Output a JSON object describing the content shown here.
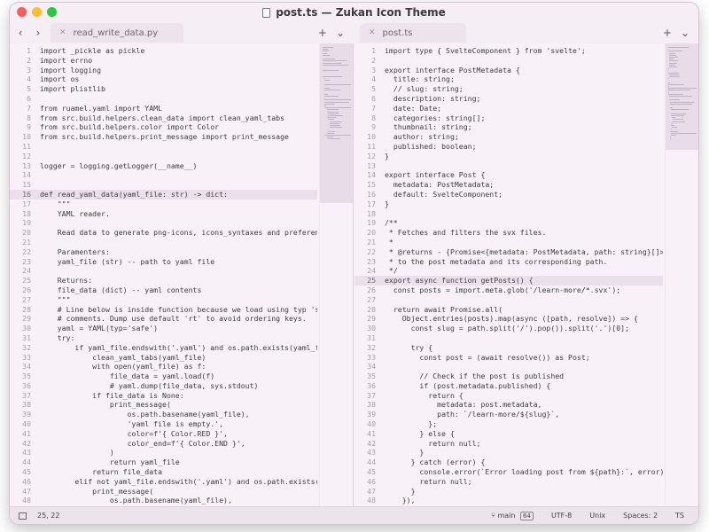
{
  "window": {
    "title": "post.ts — Zukan Icon Theme",
    "colors": {
      "close": "#ff5f57",
      "minimize": "#febc2e",
      "maximize": "#28c840",
      "background": "#f5eef5"
    }
  },
  "left_pane": {
    "tab": {
      "label": "read_write_data.py"
    },
    "active_line": "16",
    "lines": [
      {
        "n": "1",
        "t": "import _pickle as pickle"
      },
      {
        "n": "2",
        "t": "import errno"
      },
      {
        "n": "3",
        "t": "import logging"
      },
      {
        "n": "4",
        "t": "import os"
      },
      {
        "n": "5",
        "t": "import plistlib"
      },
      {
        "n": "6",
        "t": ""
      },
      {
        "n": "7",
        "t": "from ruamel.yaml import YAML"
      },
      {
        "n": "8",
        "t": "from src.build.helpers.clean_data import clean_yaml_tabs"
      },
      {
        "n": "9",
        "t": "from src.build.helpers.color import Color"
      },
      {
        "n": "10",
        "t": "from src.build.helpers.print_message import print_message"
      },
      {
        "n": "11",
        "t": ""
      },
      {
        "n": "12",
        "t": ""
      },
      {
        "n": "13",
        "t": "logger = logging.getLogger(__name__)"
      },
      {
        "n": "14",
        "t": ""
      },
      {
        "n": "15",
        "t": ""
      },
      {
        "n": "16",
        "t": "def read_yaml_data(yaml_file: str) -> dict:"
      },
      {
        "n": "17",
        "t": "    \"\"\""
      },
      {
        "n": "18",
        "t": "    YAML reader."
      },
      {
        "n": "19",
        "t": ""
      },
      {
        "n": "20",
        "t": "    Read data to generate png-icons, icons_syntaxes and preferenc"
      },
      {
        "n": "21",
        "t": ""
      },
      {
        "n": "22",
        "t": "    Paramenters:"
      },
      {
        "n": "23",
        "t": "    yaml_file (str) -- path to yaml file"
      },
      {
        "n": "24",
        "t": ""
      },
      {
        "n": "25",
        "t": "    Returns:"
      },
      {
        "n": "26",
        "t": "    file_data (dict) -- yaml contents"
      },
      {
        "n": "27",
        "t": "    \"\"\""
      },
      {
        "n": "28",
        "t": "    # Line below is inside function because we load using typ 'sa"
      },
      {
        "n": "29",
        "t": "    # comments. Dump use default 'rt' to avoid ordering keys."
      },
      {
        "n": "30",
        "t": "    yaml = YAML(typ='safe')"
      },
      {
        "n": "31",
        "t": "    try:"
      },
      {
        "n": "32",
        "t": "        if yaml_file.endswith('.yaml') and os.path.exists(yaml_fi"
      },
      {
        "n": "33",
        "t": "            clean_yaml_tabs(yaml_file)"
      },
      {
        "n": "34",
        "t": "            with open(yaml_file) as f:"
      },
      {
        "n": "35",
        "t": "                file_data = yaml.load(f)"
      },
      {
        "n": "36",
        "t": "                # yaml.dump(file_data, sys.stdout)"
      },
      {
        "n": "37",
        "t": "            if file_data is None:"
      },
      {
        "n": "38",
        "t": "                print_message("
      },
      {
        "n": "39",
        "t": "                    os.path.basename(yaml_file),"
      },
      {
        "n": "40",
        "t": "                    'yaml file is empty.',"
      },
      {
        "n": "41",
        "t": "                    color=f'{ Color.RED }',"
      },
      {
        "n": "42",
        "t": "                    color_end=f'{ Color.END }',"
      },
      {
        "n": "43",
        "t": "                )"
      },
      {
        "n": "44",
        "t": "                return yaml_file"
      },
      {
        "n": "45",
        "t": "            return file_data"
      },
      {
        "n": "46",
        "t": "        elif not yaml_file.endswith('.yaml') and os.path.exists(y"
      },
      {
        "n": "47",
        "t": "            print_message("
      },
      {
        "n": "48",
        "t": "                os.path.basename(yaml_file),"
      }
    ]
  },
  "right_pane": {
    "tab": {
      "label": "post.ts"
    },
    "active_line": "25",
    "lines": [
      {
        "n": "1",
        "t": "import type { SvelteComponent } from 'svelte';"
      },
      {
        "n": "2",
        "t": ""
      },
      {
        "n": "3",
        "t": "export interface PostMetadata {"
      },
      {
        "n": "4",
        "t": "  title: string;"
      },
      {
        "n": "5",
        "t": "  // slug: string;"
      },
      {
        "n": "6",
        "t": "  description: string;"
      },
      {
        "n": "7",
        "t": "  date: Date;"
      },
      {
        "n": "8",
        "t": "  categories: string[];"
      },
      {
        "n": "9",
        "t": "  thumbnail: string;"
      },
      {
        "n": "10",
        "t": "  author: string;"
      },
      {
        "n": "11",
        "t": "  published: boolean;"
      },
      {
        "n": "12",
        "t": "}"
      },
      {
        "n": "13",
        "t": ""
      },
      {
        "n": "14",
        "t": "export interface Post {"
      },
      {
        "n": "15",
        "t": "  metadata: PostMetadata;"
      },
      {
        "n": "16",
        "t": "  default: SvelteComponent;"
      },
      {
        "n": "17",
        "t": "}"
      },
      {
        "n": "18",
        "t": ""
      },
      {
        "n": "19",
        "t": "/**"
      },
      {
        "n": "20",
        "t": " * Fetches and filters the svx files."
      },
      {
        "n": "21",
        "t": " *"
      },
      {
        "n": "22",
        "t": " * @returns - {Promise<{metadata: PostMetadata, path: string}[]>}"
      },
      {
        "n": "23",
        "t": " * to the post metadata and its corresponding path."
      },
      {
        "n": "24",
        "t": " */"
      },
      {
        "n": "25",
        "t": "export async function getPosts() {"
      },
      {
        "n": "26",
        "t": "  const posts = import.meta.glob('/learn-more/*.svx');"
      },
      {
        "n": "27",
        "t": ""
      },
      {
        "n": "28",
        "t": "  return await Promise.all("
      },
      {
        "n": "29",
        "t": "    Object.entries(posts).map(async ([path, resolve]) => {"
      },
      {
        "n": "30",
        "t": "      const slug = path.split('/').pop()).split('.')[0];"
      },
      {
        "n": "31",
        "t": ""
      },
      {
        "n": "32",
        "t": "      try {"
      },
      {
        "n": "33",
        "t": "        const post = (await resolve()) as Post;"
      },
      {
        "n": "34",
        "t": ""
      },
      {
        "n": "35",
        "t": "        // Check if the post is published"
      },
      {
        "n": "36",
        "t": "        if (post.metadata.published) {"
      },
      {
        "n": "37",
        "t": "          return {"
      },
      {
        "n": "38",
        "t": "            metadata: post.metadata,"
      },
      {
        "n": "39",
        "t": "            path: `/learn-more/${slug}`,"
      },
      {
        "n": "40",
        "t": "          };"
      },
      {
        "n": "41",
        "t": "        } else {"
      },
      {
        "n": "42",
        "t": "          return null;"
      },
      {
        "n": "43",
        "t": "        }"
      },
      {
        "n": "44",
        "t": "      } catch (error) {"
      },
      {
        "n": "45",
        "t": "        console.error(`Error loading post from ${path}:`, error);"
      },
      {
        "n": "46",
        "t": "        return null;"
      },
      {
        "n": "47",
        "t": "      }"
      },
      {
        "n": "48",
        "t": "    }),"
      }
    ]
  },
  "status": {
    "position": "25, 22",
    "branch": "main",
    "branch_count": "64",
    "encoding": "UTF-8",
    "line_endings": "Unix",
    "indentation": "Spaces: 2",
    "syntax": "TS"
  },
  "icons": {
    "back": "chevron-left-icon",
    "forward": "chevron-right-icon",
    "new_tab": "plus-icon",
    "tab_menu": "chevron-down-icon",
    "tab_close": "close-icon",
    "file": "file-icon",
    "panel_toggle": "panel-icon",
    "branch": "branch-icon"
  }
}
